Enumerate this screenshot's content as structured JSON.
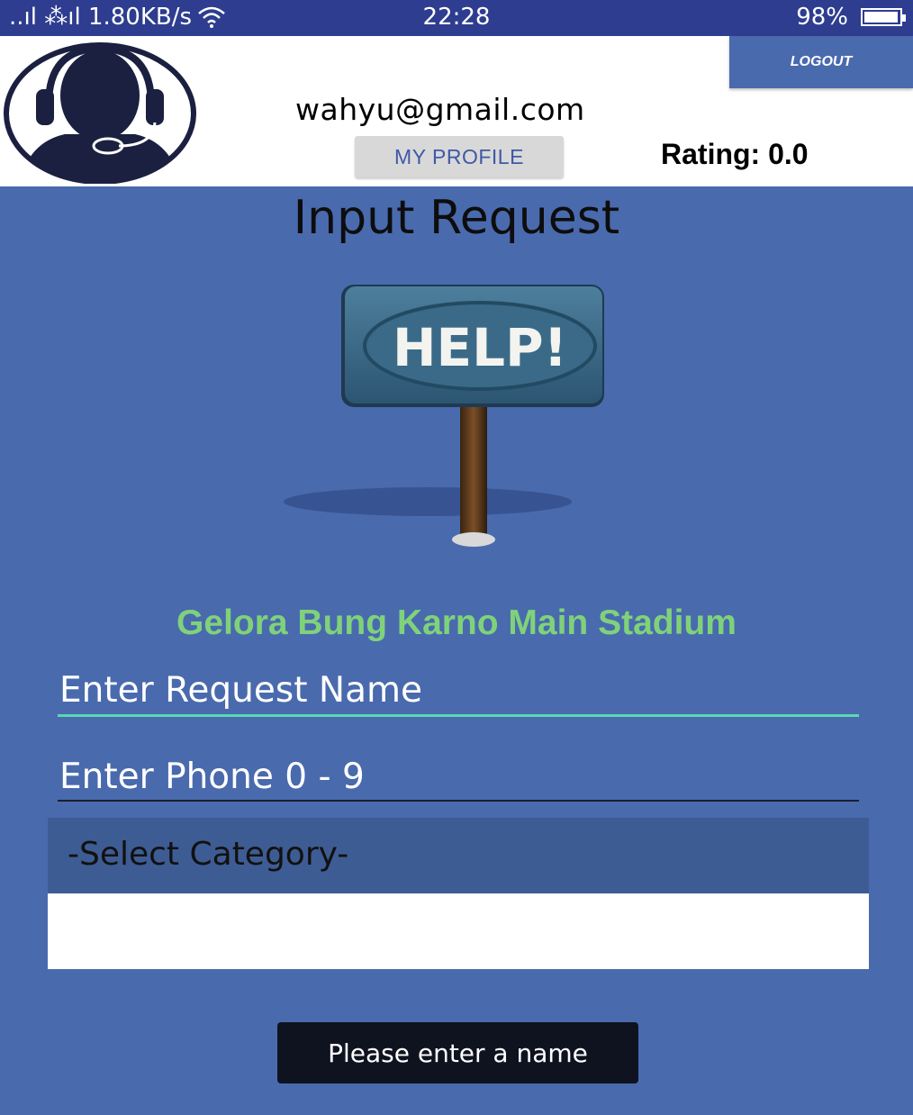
{
  "status_bar": {
    "signal_text": "..ıl ⁂ıl 1.80KB/s",
    "time": "22:28",
    "battery": "98%",
    "battery_level": 0.98
  },
  "header": {
    "email": "wahyu@gmail.com",
    "profile_button": "MY PROFILE",
    "rating": "Rating: 0.0",
    "logout_button": "LOGOUT"
  },
  "main": {
    "title": "Input Request",
    "sign_text": "HELP!",
    "venue": "Gelora Bung Karno Main Stadium",
    "request_name_placeholder": "Enter Request Name",
    "phone_placeholder": "Enter Phone 0 - 9",
    "category_selected": "-Select Category-"
  },
  "toast": {
    "message": "Please enter a name"
  },
  "colors": {
    "status_bar": "#2e3d8f",
    "background": "#4a6aae",
    "venue_text": "#7fd27a",
    "active_underline": "#5ad8b3",
    "toast": "#0f1320"
  }
}
